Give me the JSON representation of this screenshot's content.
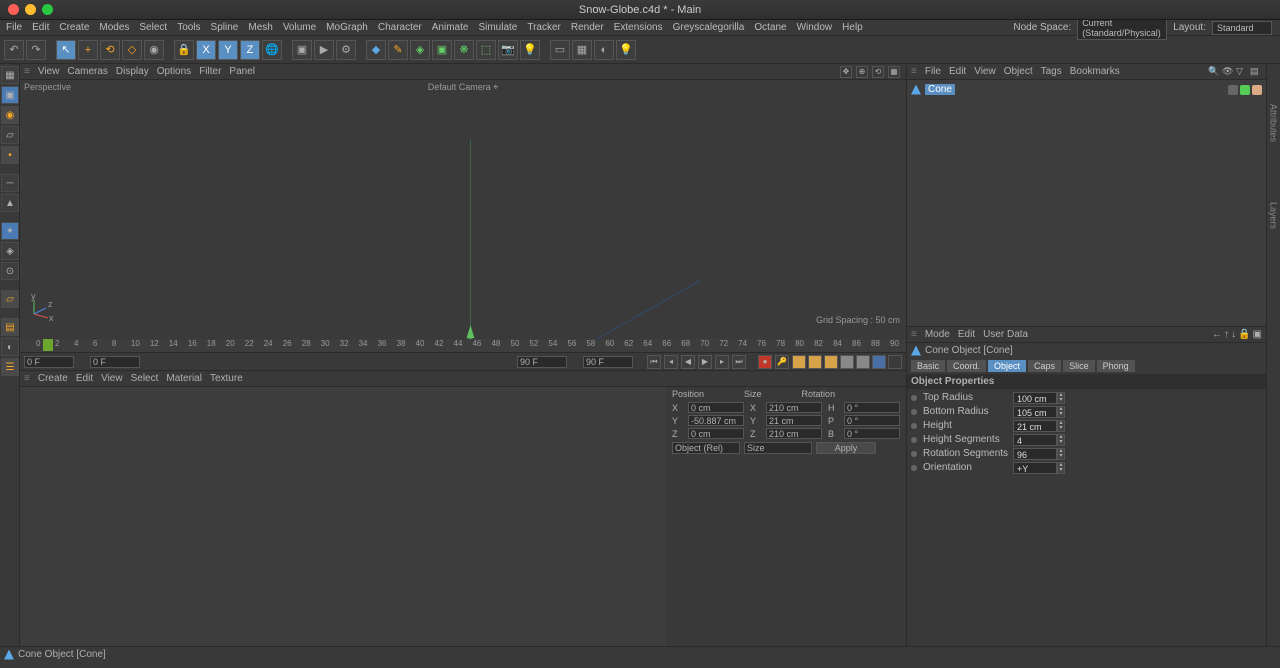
{
  "window": {
    "title": "Snow-Globe.c4d * - Main"
  },
  "menubar": {
    "items": [
      "File",
      "Edit",
      "Create",
      "Modes",
      "Select",
      "Tools",
      "Spline",
      "Mesh",
      "Volume",
      "MoGraph",
      "Character",
      "Animate",
      "Simulate",
      "Tracker",
      "Render",
      "Extensions",
      "Greyscalegorilla",
      "Octane",
      "Window",
      "Help"
    ],
    "node_space_label": "Node Space:",
    "node_space": "Current (Standard/Physical)",
    "layout_label": "Layout:",
    "layout": "Standard"
  },
  "viewport": {
    "menu": [
      "View",
      "Cameras",
      "Display",
      "Options",
      "Filter",
      "Panel"
    ],
    "mode": "Perspective",
    "camera": "Default Camera",
    "grid": "Grid Spacing : 50 cm"
  },
  "objmgr": {
    "menu": [
      "File",
      "Edit",
      "View",
      "Object",
      "Tags",
      "Bookmarks"
    ],
    "item": "Cone"
  },
  "attr": {
    "menu": [
      "Mode",
      "Edit",
      "User Data"
    ],
    "title": "Cone Object [Cone]",
    "tabs": [
      "Basic",
      "Coord.",
      "Object",
      "Caps",
      "Slice",
      "Phong"
    ],
    "active_tab": 2,
    "section": "Object Properties",
    "props": [
      {
        "label": "Top Radius",
        "value": "100 cm"
      },
      {
        "label": "Bottom Radius",
        "value": "105 cm"
      },
      {
        "label": "Height",
        "value": "21 cm"
      },
      {
        "label": "Height Segments",
        "value": "4"
      },
      {
        "label": "Rotation Segments",
        "value": "96"
      },
      {
        "label": "Orientation",
        "value": "+Y"
      }
    ]
  },
  "timeline": {
    "start": "0 F",
    "start2": "0 F",
    "end": "90 F",
    "end2": "90 F",
    "ticks": [
      0,
      2,
      4,
      6,
      8,
      10,
      12,
      14,
      16,
      18,
      20,
      22,
      24,
      26,
      28,
      30,
      32,
      34,
      36,
      38,
      40,
      42,
      44,
      46,
      48,
      50,
      52,
      54,
      56,
      58,
      60,
      62,
      64,
      66,
      68,
      70,
      72,
      74,
      76,
      78,
      80,
      82,
      84,
      86,
      88,
      90
    ]
  },
  "matbar": {
    "items": [
      "Create",
      "Edit",
      "View",
      "Select",
      "Material",
      "Texture"
    ]
  },
  "coord": {
    "headers": [
      "Position",
      "Size",
      "Rotation"
    ],
    "rows": [
      {
        "axis": "X",
        "pos": "0 cm",
        "size": "210 cm",
        "rot": "0 °",
        "rl": "H"
      },
      {
        "axis": "Y",
        "pos": "-50.887 cm",
        "size": "21 cm",
        "rot": "0 °",
        "rl": "P"
      },
      {
        "axis": "Z",
        "pos": "0 cm",
        "size": "210 cm",
        "rot": "0 °",
        "rl": "B"
      }
    ],
    "mode1": "Object (Rel)",
    "mode2": "Size",
    "apply": "Apply"
  },
  "status": {
    "text": "Cone Object [Cone]"
  }
}
